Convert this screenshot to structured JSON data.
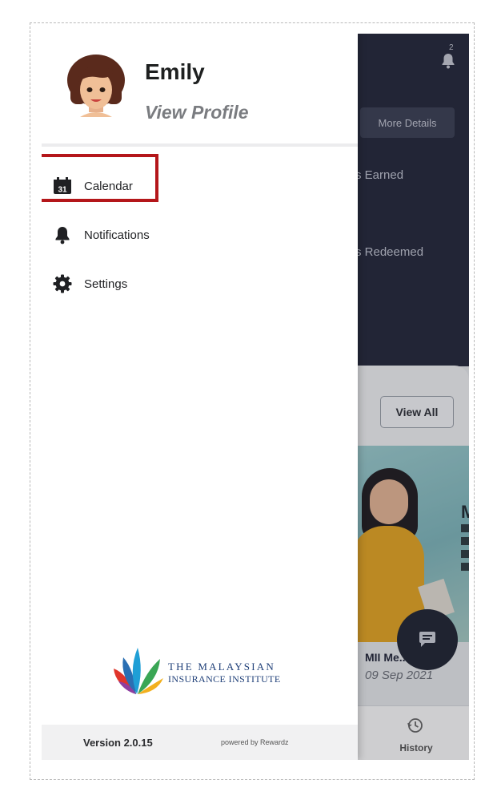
{
  "app": {
    "user": {
      "name": "Emily",
      "view_profile_label": "View Profile"
    },
    "menu": [
      {
        "id": "calendar",
        "label": "Calendar",
        "icon": "calendar-icon",
        "icon_text": "31"
      },
      {
        "id": "notifications",
        "label": "Notifications",
        "icon": "bell-icon"
      },
      {
        "id": "settings",
        "label": "Settings",
        "icon": "gear-icon"
      }
    ],
    "logo": {
      "line1": "THE MALAYSIAN",
      "line2": "INSURANCE INSTITUTE"
    },
    "footer": {
      "version": "Version 2.0.15",
      "powered_by": "powered by Rewardz"
    }
  },
  "background": {
    "notification_count": "2",
    "more_details_label": "More Details",
    "earned_label": "s Earned",
    "redeemed_label": "s Redeemed",
    "view_all_label": "View All",
    "promo_initial": "M",
    "card_title": "MII Me... Pri",
    "card_date": "09 Sep 2021",
    "history_label": "History"
  },
  "colors": {
    "highlight": "#b4161a",
    "dark_header": "#23273a",
    "logo_blue": "#1f3f78"
  }
}
